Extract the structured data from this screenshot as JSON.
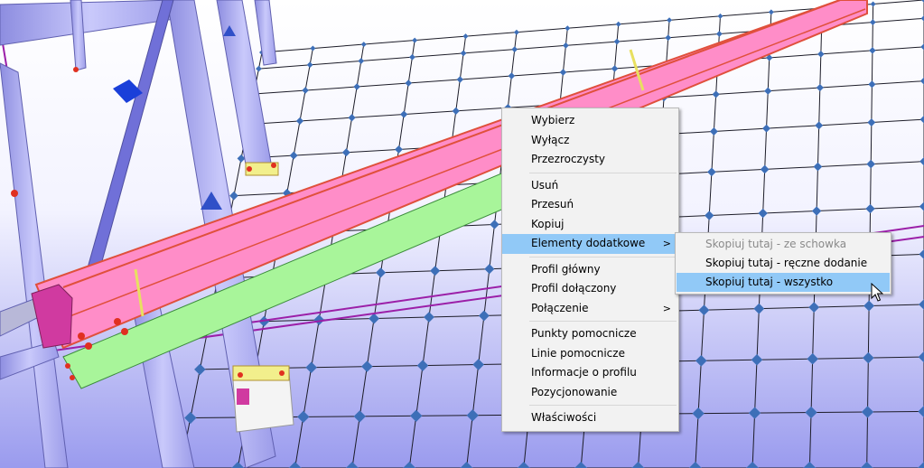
{
  "context_menu": {
    "items": [
      {
        "label": "Wybierz"
      },
      {
        "label": "Wyłącz"
      },
      {
        "label": "Przezroczysty"
      },
      {
        "label": "Usuń"
      },
      {
        "label": "Przesuń"
      },
      {
        "label": "Kopiuj"
      },
      {
        "label": "Elementy dodatkowe",
        "submenu_arrow": ">"
      },
      {
        "label": "Profil główny"
      },
      {
        "label": "Profil dołączony"
      },
      {
        "label": "Połączenie",
        "submenu_arrow": ">"
      },
      {
        "label": "Punkty pomocnicze"
      },
      {
        "label": "Linie pomocnicze"
      },
      {
        "label": "Informacje o profilu"
      },
      {
        "label": "Pozycjonowanie"
      },
      {
        "label": "Właściwości"
      }
    ]
  },
  "submenu": {
    "items": [
      {
        "label": "Skopiuj tutaj - ze schowka",
        "disabled": true
      },
      {
        "label": "Skopiuj tutaj - ręczne dodanie"
      },
      {
        "label": "Skopiuj tutaj - wszystko",
        "highlighted": true
      }
    ]
  },
  "colors": {
    "beam_pink": "#ff8dc8",
    "beam_edge": "#e0503c",
    "column_violet": "#a9a9f2",
    "plate_green": "#a8f59a",
    "grid_node": "#3d6fb8",
    "menu_highlight": "#91c9f7"
  }
}
